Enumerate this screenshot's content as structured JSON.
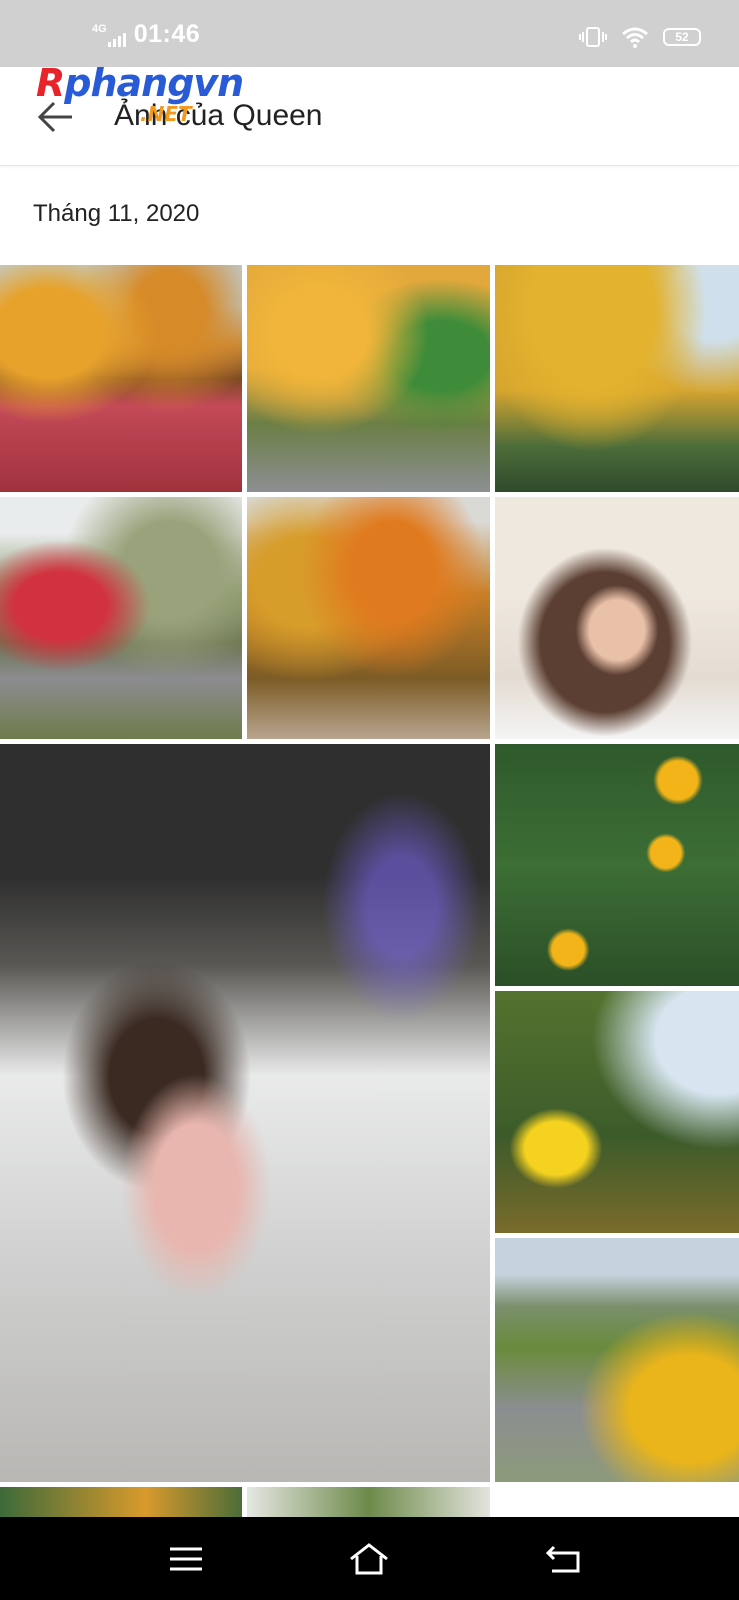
{
  "status_bar": {
    "network": "4G",
    "time": "01:46",
    "battery": "52",
    "icons": [
      "signal-icon",
      "vibrate-icon",
      "wifi-icon",
      "battery-icon"
    ]
  },
  "watermark": {
    "brand_r": "R",
    "brand_rest": "phangvn",
    "brand_suffix": ".NET"
  },
  "header": {
    "title": "Ảnh của Queen",
    "back_icon": "arrow-left-icon"
  },
  "section": {
    "date": "Tháng 11, 2020"
  },
  "photos": [
    "autumn-road-photo",
    "autumn-tree-photo",
    "yellow-tree-photo",
    "red-tree-road-photo",
    "autumn-forest-road-photo",
    "selfie-photo",
    "gallery-girl-photo",
    "sunflowers-photo",
    "yellow-flower-closeup-photo",
    "flower-road-photo",
    "partial-photo-1",
    "partial-photo-2"
  ],
  "nav_bar": {
    "icons": [
      "menu-icon",
      "home-icon",
      "back-icon"
    ]
  },
  "colors": {
    "status_bar": "#d0d0d0",
    "nav_bar": "#000000",
    "watermark_red": "#e8232a",
    "watermark_blue": "#2a5bd7",
    "watermark_orange": "#f39a1e"
  }
}
